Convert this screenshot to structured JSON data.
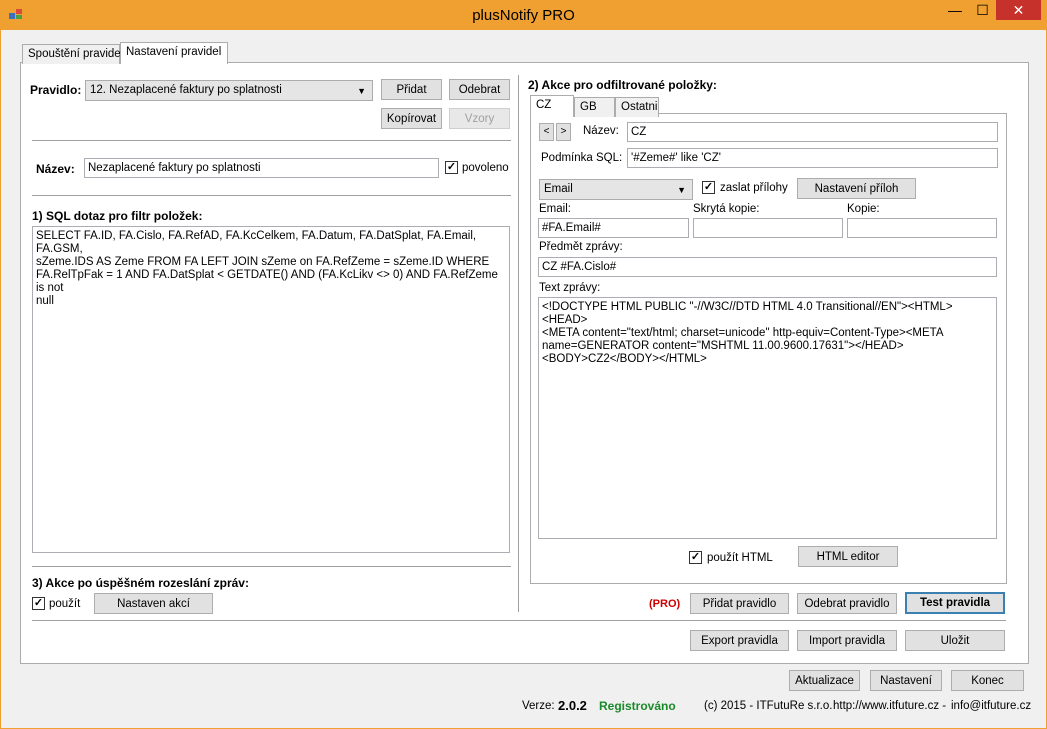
{
  "window": {
    "title": "plusNotify PRO",
    "minimize": "—",
    "maximize": "☐",
    "close": "✕"
  },
  "main_tabs": [
    {
      "label": "Spouštění pravidel"
    },
    {
      "label": "Nastavení pravidel"
    }
  ],
  "rule": {
    "label": "Pravidlo:",
    "selected": "12. Nezaplacené faktury po splatnosti",
    "add": "Přidat",
    "remove": "Odebrat",
    "copy": "Kopírovat",
    "templates": "Vzory"
  },
  "name": {
    "label": "Název:",
    "value": "Nezaplacené faktury po splatnosti",
    "enabled_label": "povoleno",
    "check": "✓"
  },
  "sql": {
    "heading": "1) SQL dotaz pro filtr položek:",
    "query": "SELECT FA.ID, FA.Cislo, FA.RefAD, FA.KcCelkem, FA.Datum, FA.DatSplat, FA.Email, FA.GSM,\nsZeme.IDS AS Zeme FROM FA LEFT JOIN sZeme on FA.RefZeme = sZeme.ID WHERE\nFA.RelTpFak = 1 AND FA.DatSplat < GETDATE() AND (FA.KcLikv <> 0) AND FA.RefZeme is not\nnull"
  },
  "after_send": {
    "heading": "3) Akce po úspěšném rozeslání zpráv:",
    "use_label": "použít",
    "settings_button": "Nastaven akcí"
  },
  "actions": {
    "heading": "2) Akce pro odfiltrované položky:",
    "tabs": [
      {
        "label": "CZ"
      },
      {
        "label": "GB"
      },
      {
        "label": "Ostatni"
      }
    ],
    "prev": "<",
    "next": ">",
    "name_label": "Název:",
    "name_value": "CZ",
    "condition_label": "Podmínka SQL:",
    "condition_value": "'#Zeme#' like 'CZ'",
    "channel": "Email",
    "attach_label": "zaslat přílohy",
    "attach_settings": "Nastavení příloh",
    "email_label": "Email:",
    "email_value": "#FA.Email#",
    "bcc_label": "Skrytá kopie:",
    "bcc_value": "",
    "cc_label": "Kopie:",
    "cc_value": "",
    "subject_label": "Předmět zprávy:",
    "subject_value": "CZ #FA.Cislo#",
    "body_label": "Text zprávy:",
    "body_value": "<!DOCTYPE HTML PUBLIC \"-//W3C//DTD HTML 4.0 Transitional//EN\"><HTML><HEAD>\n<META content=\"text/html; charset=unicode\" http-equiv=Content-Type><META\nname=GENERATOR content=\"MSHTML 11.00.9600.17631\"></HEAD>\n<BODY>CZ2</BODY></HTML>",
    "html_label": "použít HTML",
    "html_editor": "HTML editor"
  },
  "rule_buttons": {
    "pro": "(PRO)",
    "add_rule": "Přidat pravidlo",
    "remove_rule": "Odebrat pravidlo",
    "test_rule": "Test pravidla",
    "export": "Export pravidla",
    "import": "Import pravidla",
    "save": "Uložit"
  },
  "footer": {
    "update": "Aktualizace",
    "settings": "Nastavení",
    "exit": "Konec",
    "version_label": "Verze:",
    "version": "2.0.2",
    "registered": "Registrováno",
    "copyright": "(c) 2015 - ITFutuRe s.r.o.",
    "web": "http://www.itfuture.cz -",
    "email": "info@itfuture.cz"
  },
  "colors": {
    "titlebar": "#f0a030",
    "close": "#c7312b",
    "registered": "#1a8a2a",
    "pro": "#cc0000"
  }
}
